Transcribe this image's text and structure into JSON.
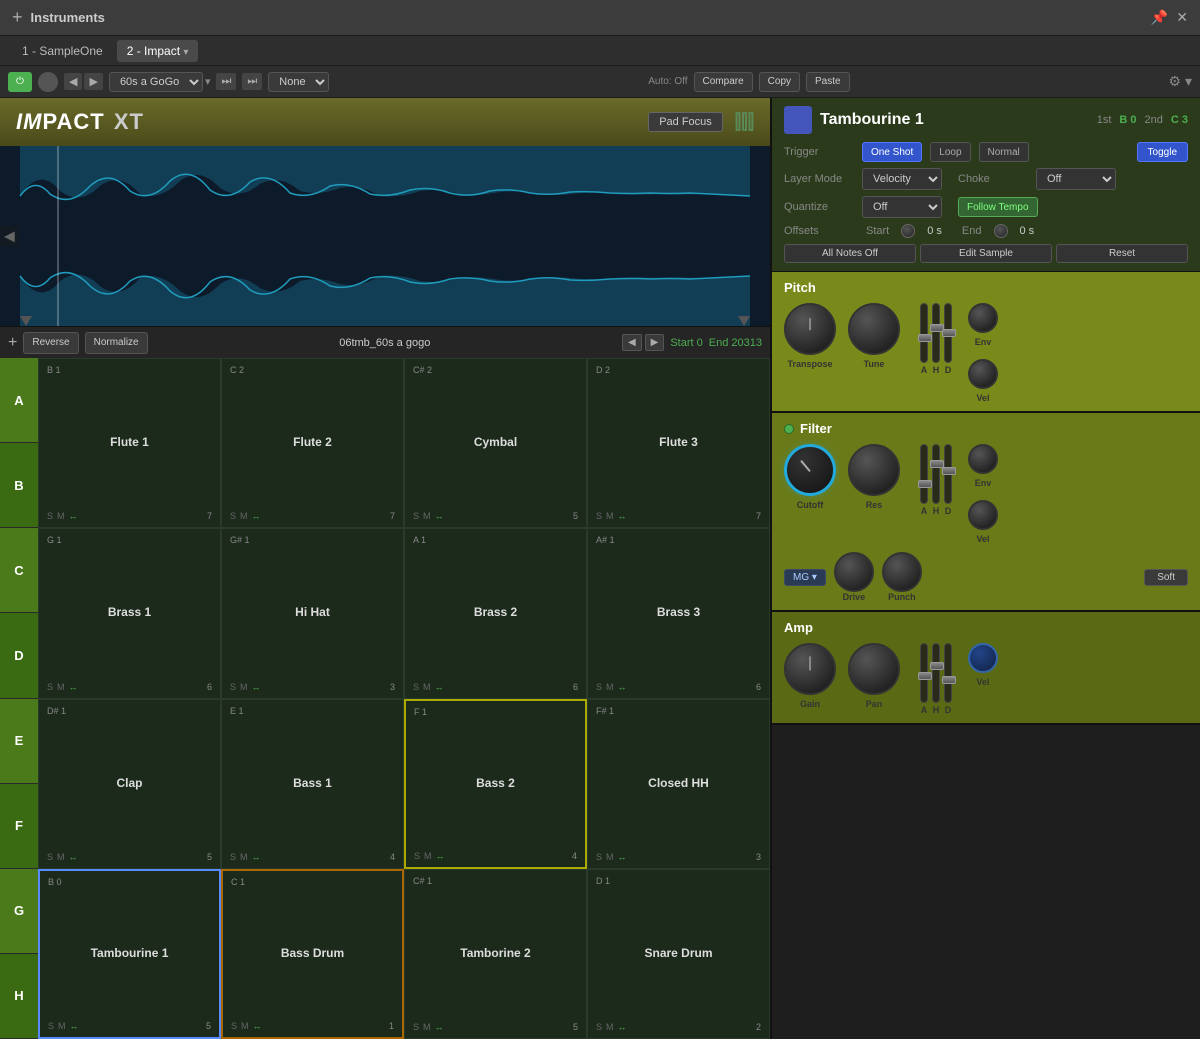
{
  "titleBar": {
    "plus": "+",
    "title": "Instruments",
    "pin": "📌",
    "close": "✕"
  },
  "tabs": [
    {
      "label": "1 - SampleOne",
      "active": false
    },
    {
      "label": "2 - Impact",
      "active": true
    }
  ],
  "toolbar": {
    "autoOff": "Auto: Off",
    "compare": "Compare",
    "copy": "Copy",
    "paste": "Paste",
    "preset": "60s a GoGo",
    "none": "None"
  },
  "plugin": {
    "title": "IMPACT XT",
    "padFocus": "Pad Focus",
    "logo": "|||"
  },
  "waveform": {
    "reverse": "Reverse",
    "normalize": "Normalize",
    "filename": "06tmb_60s a gogo",
    "startLabel": "Start",
    "startVal": "0",
    "endLabel": "End",
    "endVal": "20313"
  },
  "rowLabels": [
    "A",
    "B",
    "C",
    "D",
    "E",
    "F",
    "G",
    "H"
  ],
  "pads": [
    {
      "note": "B 1",
      "name": "Flute 1",
      "s": "S",
      "m": "M",
      "link": "↔",
      "num": "7",
      "border": "normal"
    },
    {
      "note": "C 2",
      "name": "Flute 2",
      "s": "S",
      "m": "M",
      "link": "↔",
      "num": "7",
      "border": "normal"
    },
    {
      "note": "C# 2",
      "name": "Cymbal",
      "s": "S",
      "m": "M",
      "link": "↔",
      "num": "5",
      "border": "normal"
    },
    {
      "note": "D 2",
      "name": "Flute 3",
      "s": "S",
      "m": "M",
      "link": "↔",
      "num": "7",
      "border": "normal"
    },
    {
      "note": "G 1",
      "name": "Brass 1",
      "s": "S",
      "m": "M",
      "link": "↔",
      "num": "6",
      "border": "normal"
    },
    {
      "note": "G# 1",
      "name": "Hi Hat",
      "s": "S",
      "m": "M",
      "link": "↔",
      "num": "3",
      "border": "normal"
    },
    {
      "note": "A 1",
      "name": "Brass 2",
      "s": "S",
      "m": "M",
      "link": "↔",
      "num": "6",
      "border": "normal"
    },
    {
      "note": "A# 1",
      "name": "Brass 3",
      "s": "S",
      "m": "M",
      "link": "↔",
      "num": "6",
      "border": "normal"
    },
    {
      "note": "D# 1",
      "name": "Clap",
      "s": "S",
      "m": "M",
      "link": "↔",
      "num": "5",
      "border": "normal"
    },
    {
      "note": "E 1",
      "name": "Bass 1",
      "s": "S",
      "m": "M",
      "link": "↔",
      "num": "4",
      "border": "normal"
    },
    {
      "note": "F 1",
      "name": "Bass 2",
      "s": "S",
      "m": "M",
      "link": "↔",
      "num": "4",
      "border": "yellow"
    },
    {
      "note": "F# 1",
      "name": "Closed HH",
      "s": "S",
      "m": "M",
      "link": "↔",
      "num": "3",
      "border": "normal"
    },
    {
      "note": "B 0",
      "name": "Tambourine 1",
      "s": "S",
      "m": "M",
      "link": "↔",
      "num": "5",
      "border": "selected"
    },
    {
      "note": "C 1",
      "name": "Bass Drum",
      "s": "S",
      "m": "M",
      "link": "↔",
      "num": "1",
      "border": "orange"
    },
    {
      "note": "C# 1",
      "name": "Tamborine 2",
      "s": "S",
      "m": "M",
      "link": "↔",
      "num": "5",
      "border": "normal"
    },
    {
      "note": "D 1",
      "name": "Snare Drum",
      "s": "S",
      "m": "M",
      "link": "↔",
      "num": "2",
      "border": "normal"
    }
  ],
  "padInfo": {
    "instName": "Tambourine 1",
    "key1Label": "1st",
    "key1Val": "B 0",
    "key2Label": "2nd",
    "key2Val": "C 3",
    "triggerLabel": "Trigger",
    "triggerBtns": [
      "One Shot",
      "Loop",
      "Normal",
      "Toggle"
    ],
    "layerLabel": "Layer Mode",
    "layerVal": "Velocity",
    "chokeLabel": "Choke",
    "chokeVal": "Off",
    "quantizeLabel": "Quantize",
    "quantizeVal": "Off",
    "followTempo": "Follow Tempo",
    "offsetsLabel": "Offsets",
    "startLabel": "Start",
    "startVal": "0 s",
    "endLabel": "End",
    "endVal": "0 s",
    "actions": [
      "All Notes Off",
      "Edit Sample",
      "Reset"
    ]
  },
  "pitch": {
    "title": "Pitch",
    "knobs": [
      {
        "label": "Transpose"
      },
      {
        "label": "Tune"
      }
    ],
    "faders": [
      "A",
      "H",
      "D"
    ],
    "envLabel": "Env",
    "velLabel": "Vel"
  },
  "filter": {
    "title": "Filter",
    "knobs": [
      {
        "label": "Cutoff"
      },
      {
        "label": "Res"
      }
    ],
    "faders": [
      "A",
      "H",
      "D"
    ],
    "envLabel": "Env",
    "velLabel": "Vel",
    "filterType": "MG",
    "driveLabel": "Drive",
    "punchLabel": "Punch",
    "softLabel": "Soft"
  },
  "amp": {
    "title": "Amp",
    "knobs": [
      {
        "label": "Gain"
      },
      {
        "label": "Pan"
      }
    ],
    "faders": [
      "A",
      "H",
      "D"
    ],
    "velLabel": "Vel"
  }
}
